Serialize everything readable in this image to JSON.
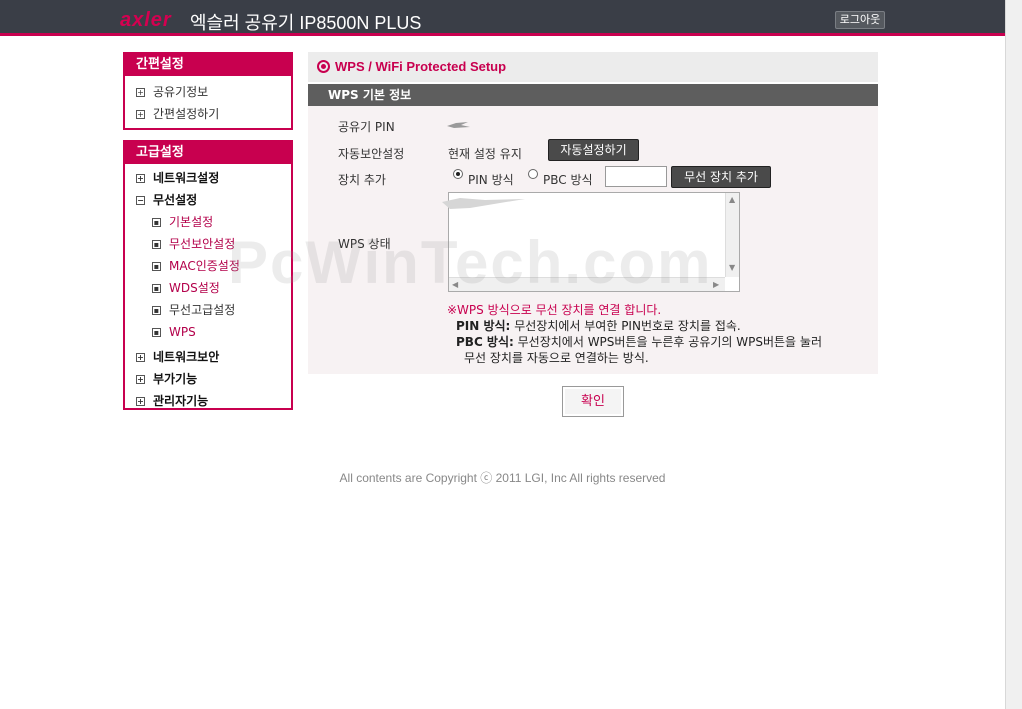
{
  "header": {
    "logo_text": "axler",
    "title": "엑슬러 공유기 IP8500N PLUS",
    "logout_label": "로그아웃"
  },
  "quick_menu": {
    "title": "간편설정",
    "items": [
      {
        "label": "공유기정보"
      },
      {
        "label": "간편설정하기"
      }
    ]
  },
  "advanced_menu": {
    "title": "고급설정",
    "items": [
      {
        "label": "네트워크설정"
      },
      {
        "label": "무선설정"
      },
      {
        "label": "기본설정"
      },
      {
        "label": "무선보안설정"
      },
      {
        "label": "MAC인증설정"
      },
      {
        "label": "WDS설정"
      },
      {
        "label": "무선고급설정"
      },
      {
        "label": "WPS"
      },
      {
        "label": "네트워크보안"
      },
      {
        "label": "부가기능"
      },
      {
        "label": "관리자기능"
      }
    ]
  },
  "main": {
    "title": "WPS / WiFi Protected Setup",
    "section_title": "WPS 기본 정보",
    "router_pin_label": "공유기 PIN",
    "auto_security_label": "자동보안설정",
    "auto_security_value": "현재 설정 유지",
    "auto_config_button": "자동설정하기",
    "add_device_label": "장치 추가",
    "pin_method_label": "PIN 방식",
    "pbc_method_label": "PBC 방식",
    "add_wireless_button": "무선 장치 추가",
    "wps_status_label": "WPS 상태",
    "notice_line": "※WPS 방식으로 무선 장치를 연결 합니다.",
    "pin_method_title": "PIN 방식:",
    "pin_method_desc": "무선장치에서 부여한 PIN번호로 장치를 접속.",
    "pbc_method_title": "PBC 방식:",
    "pbc_method_desc": "무선장치에서 WPS버튼을 누른후 공유기의 WPS버튼을 눌러",
    "pbc_method_desc2": "무선 장치를 자동으로 연결하는 방식.",
    "confirm_button": "확인"
  },
  "footer": {
    "copyright": "All contents are Copyright ⓒ 2011 LGI, Inc All rights reserved"
  },
  "watermark": "PcWinTech.com",
  "colors": {
    "accent": "#c8004f",
    "header_bg": "#3a3e47",
    "section_bar": "#5e5e5e",
    "content_bg": "#f7f2f3"
  }
}
